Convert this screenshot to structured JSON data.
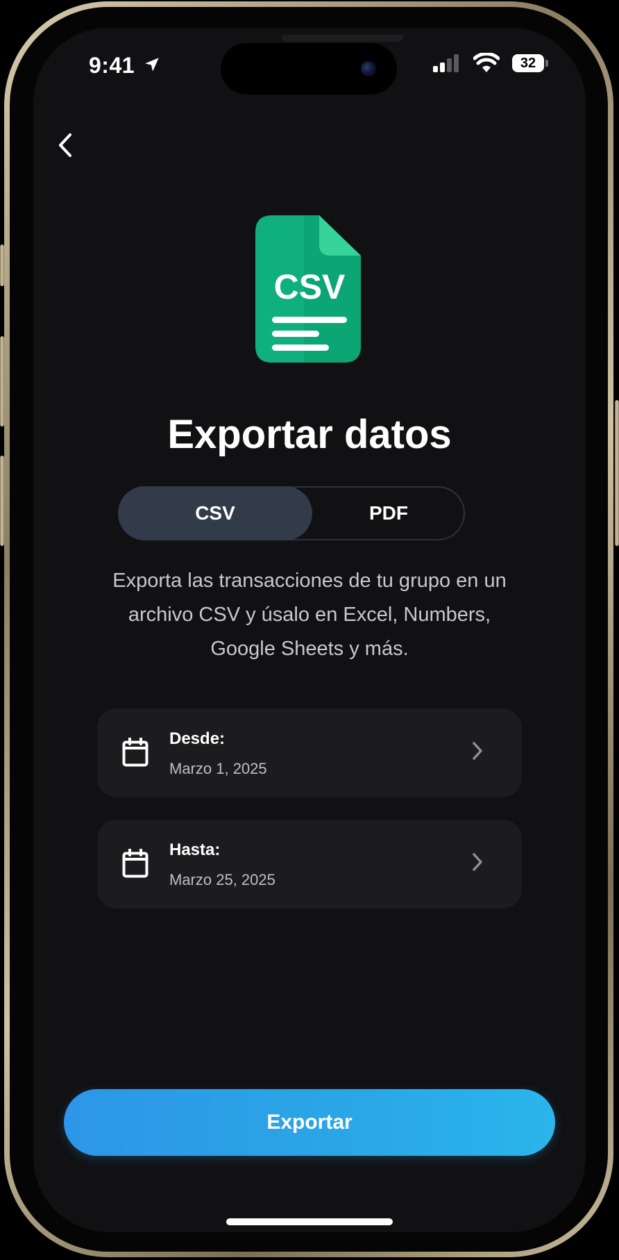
{
  "status_bar": {
    "time": "9:41",
    "battery": "32"
  },
  "navigation": {
    "back_icon": "chevron-left-icon"
  },
  "file_icon": {
    "label": "CSV",
    "color": "#11b57f"
  },
  "title": "Exportar datos",
  "format_toggle": {
    "options": [
      "CSV",
      "PDF"
    ],
    "selected": "CSV"
  },
  "description_lines": [
    "Exporta las transacciones de tu grupo en un",
    "archivo CSV y úsalo en Excel, Numbers,",
    "Google Sheets y más."
  ],
  "date_range": [
    {
      "label": "Desde:",
      "value": "Marzo 1, 2025",
      "icon": "calendar-icon"
    },
    {
      "label": "Hasta:",
      "value": "Marzo 25, 2025",
      "icon": "calendar-icon"
    }
  ],
  "export_button": {
    "label": "Exportar",
    "color": "#2a9fe8"
  },
  "colors": {
    "background": "#111114",
    "card": "#1c1c1f",
    "segment_active": "#313b4a"
  }
}
